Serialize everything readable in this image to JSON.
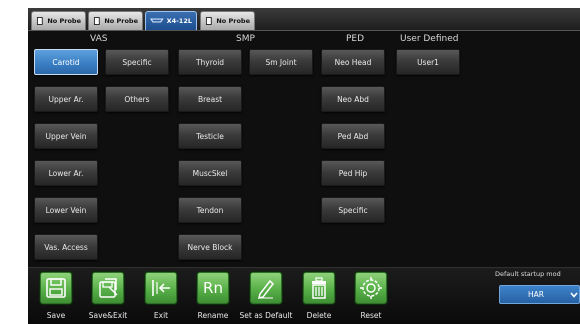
{
  "probe_tabs": [
    {
      "label": "No Probe",
      "icon": "empty-probe-icon",
      "active": false
    },
    {
      "label": "No Probe",
      "icon": "empty-probe-icon",
      "active": false
    },
    {
      "label": "X4-12L",
      "icon": "linear-probe-icon",
      "active": true
    },
    {
      "label": "No Probe",
      "icon": "empty-probe-icon",
      "active": false
    }
  ],
  "categories": [
    "VAS",
    "SMP",
    "PED",
    "User Defined"
  ],
  "presets": {
    "vas_col1": [
      "Carotid",
      "Upper Ar.",
      "Upper Vein",
      "Lower Ar.",
      "Lower Vein",
      "Vas. Access"
    ],
    "vas_col2": [
      "Specific",
      "Others"
    ],
    "smp_col1": [
      "Thyroid",
      "Breast",
      "Testicle",
      "MuscSkel",
      "Tendon",
      "Nerve Block"
    ],
    "smp_col2": [
      "Sm Joint"
    ],
    "ped": [
      "Neo Head",
      "Neo Abd",
      "Ped Abd",
      "Ped Hip",
      "Specific"
    ],
    "user": [
      "User1"
    ],
    "selected": "Carotid"
  },
  "toolbar": {
    "items": [
      {
        "label": "Save",
        "icon": "floppy-disk-icon"
      },
      {
        "label": "Save&Exit",
        "icon": "save-exit-icon"
      },
      {
        "label": "Exit",
        "icon": "exit-arrow-icon"
      },
      {
        "label": "Rename",
        "icon": "rename-icon",
        "glyph": "Rn"
      },
      {
        "label": "Set as Default",
        "icon": "pencil-icon"
      },
      {
        "label": "Delete",
        "icon": "trash-icon"
      },
      {
        "label": "Reset",
        "icon": "reset-gear-icon"
      }
    ]
  },
  "default_startup": {
    "label": "Default startup mod",
    "value": "HAR"
  },
  "colors": {
    "accent_blue": "#3b7fc4",
    "tool_green": "#58b048",
    "background": "#0f0f10"
  }
}
